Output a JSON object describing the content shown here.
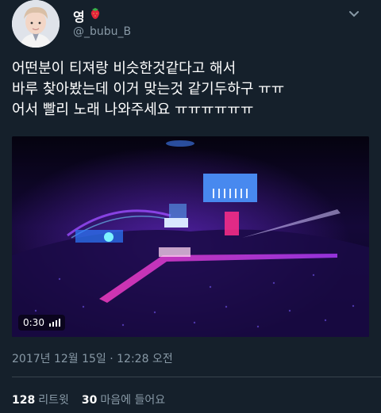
{
  "header": {
    "display_name": "영",
    "handle": "@_bubu_B"
  },
  "tweet": {
    "lines": [
      "어떤분이 티져랑 비슷한것같다고 해서",
      "바루 찾아봤는데 이거 맞는것 같기두하구 ㅠㅠ",
      "어서 빨리 노래 나와주세요 ㅠㅠㅠㅠㅠㅠ"
    ]
  },
  "media": {
    "duration": "0:30"
  },
  "timestamp": "2017년 12월 15일 · 12:28 오전",
  "stats": {
    "retweets_count": "128",
    "retweets_label": "리트윗",
    "likes_count": "30",
    "likes_label": "마음에 들어요"
  },
  "colors": {
    "background": "#15202b",
    "secondary_text": "#8899a6",
    "divider": "#38444d"
  }
}
